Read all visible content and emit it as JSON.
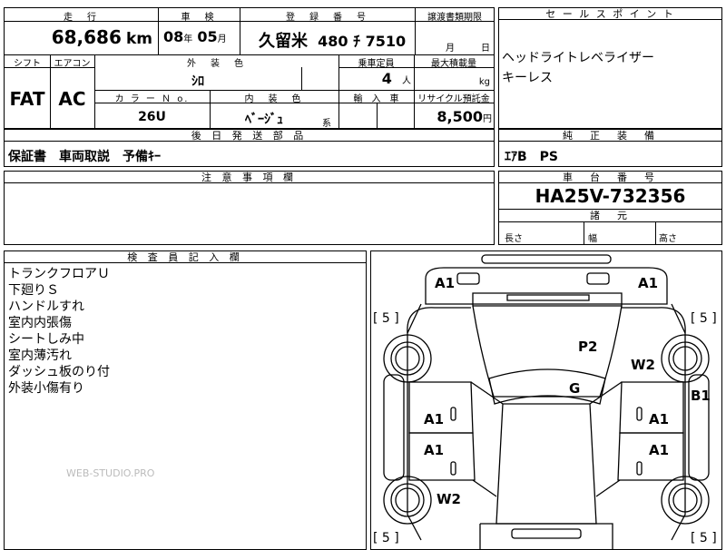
{
  "headers": {
    "mileage": "走　行",
    "inspection": "車　検",
    "registration": "登　録　番　号",
    "transfer_doc": "譲渡書類期限",
    "sales_point": "セ ー ル ス ポ イ ン ト",
    "shift": "シフト",
    "aircon": "エアコン",
    "ext_color": "外　装　色",
    "capacity": "乗車定員",
    "max_load": "最大積載量",
    "color_no": "カ ラ ー Ｎ o.",
    "int_color": "内　装　色",
    "import": "輸　入　車",
    "recycle": "リサイクル預託金",
    "later_parts": "後 日 発 送 部 品",
    "standard_equip": "純　正　装　備",
    "notes": "注 意 事 項 欄",
    "chassis": "車　台　番　号",
    "dimensions": "諸　元",
    "inspector": "検 査 員 記 入 欄"
  },
  "values": {
    "mileage": "68,686",
    "mileage_unit": "km",
    "inspect_year": "08",
    "year_unit": "年",
    "inspect_month": "05",
    "month_unit": "月",
    "reg_area": "久留米",
    "reg_number": "480 ﾁ 7510",
    "transfer_month": "月",
    "transfer_day": "日",
    "shift": "FAT",
    "aircon": "AC",
    "ext_color": "ｼﾛ",
    "capacity": "4",
    "capacity_unit": "人",
    "max_load_unit": "kg",
    "color_no": "26U",
    "int_color": "ﾍﾞｰｼﾞｭ",
    "int_color_suffix": "系",
    "recycle": "8,500",
    "recycle_unit": "円",
    "later_parts": "保証書　車両取説　予備ｷｰ",
    "standard_equip": "ｴｱB　PS",
    "chassis": "HA25V-732356",
    "length": "長さ",
    "width": "幅",
    "height": "高さ"
  },
  "sales_points": [
    "ヘッドライトレベライザー",
    "キーレス"
  ],
  "inspector_notes": [
    "トランクフロアＵ",
    "下廻りＳ",
    "ハンドルすれ",
    "室内内張傷",
    "シートしみ中",
    "室内薄汚れ",
    "ダッシュ板のり付",
    "外装小傷有り"
  ],
  "watermark": "WEB-STUDIO.PRO",
  "diagram": {
    "a1_front_left": "A1",
    "a1_front_right": "A1",
    "bracket_left_top": "[ 5 ]",
    "bracket_right_top": "[ 5 ]",
    "bracket_left_bottom": "[ 5 ]",
    "bracket_right_bottom": "[ 5 ]",
    "p2": "P2",
    "w2_right": "W2",
    "g": "G",
    "b1": "B1",
    "a1_mid_left_1": "A1",
    "a1_mid_right_1": "A1",
    "a1_mid_left_2": "A1",
    "a1_mid_right_2": "A1",
    "w2_left": "W2"
  }
}
